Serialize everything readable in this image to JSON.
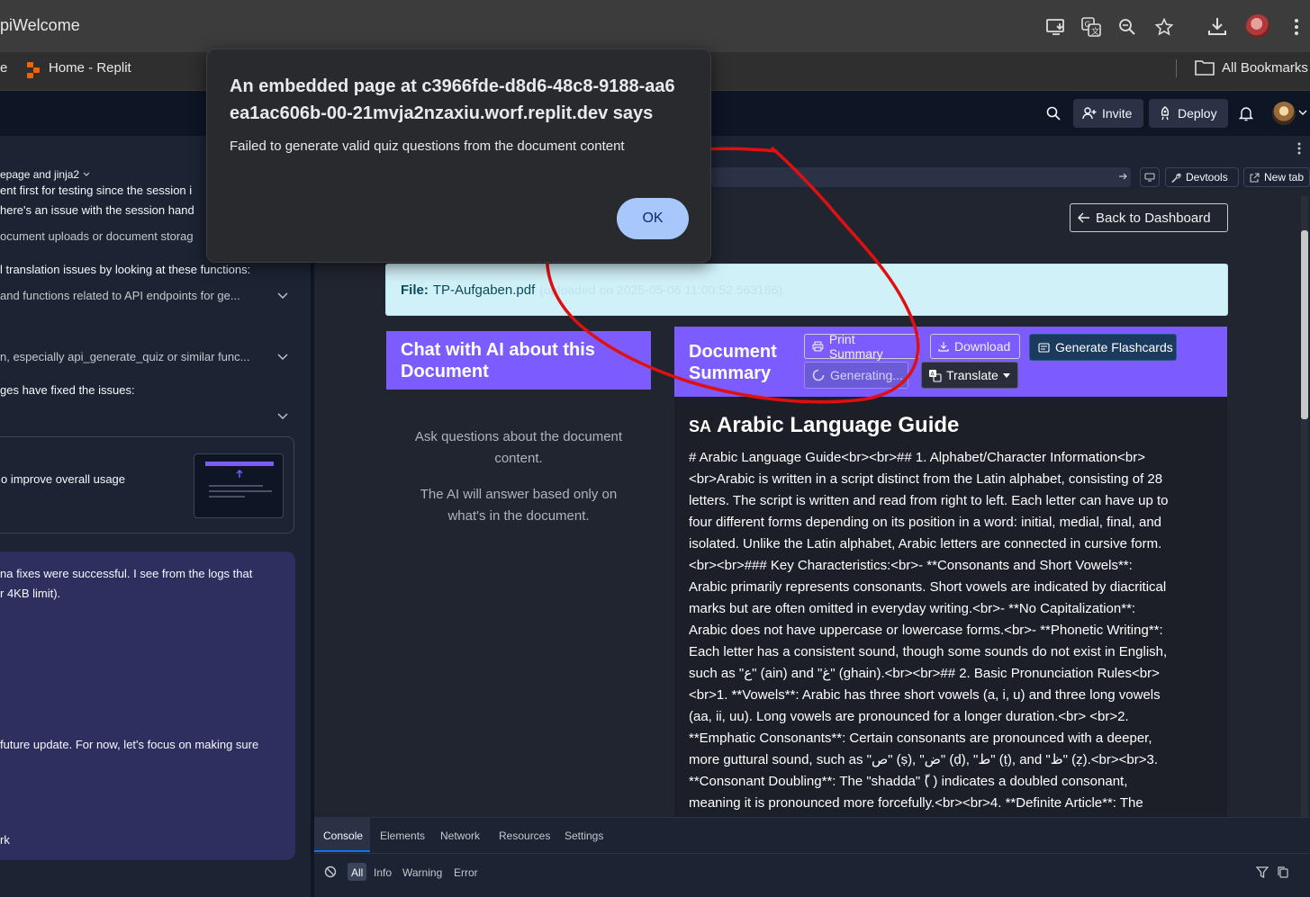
{
  "browser": {
    "tab_title": "piWelcome",
    "bookmarks": [
      {
        "label": "e"
      },
      {
        "label": "Home - Replit"
      }
    ],
    "all_bookmarks": "All Bookmarks"
  },
  "replit_header": {
    "invite": "Invite",
    "deploy": "Deploy"
  },
  "left_panel": {
    "chip": "epage and jinja2",
    "lines": [
      "ent first for testing since the session i",
      "here's an issue with the session hand",
      "ocument uploads or document storag",
      "l translation issues by looking at these functions:",
      "and functions related to API endpoints for ge...",
      "n, especially api_generate_quiz or similar func...",
      "ges have fixed the issues:",
      "o improve overall usage",
      "na fixes were successful. I see from the logs that",
      "r 4KB limit).",
      "future update. For now, let's focus on making sure",
      "rk"
    ]
  },
  "webview_toolbar": {
    "devtools": "Devtools",
    "new_tab": "New tab"
  },
  "app": {
    "back_button": "Back to Dashboard",
    "file_label": "File:",
    "file_name": "TP-Aufgaben.pdf",
    "file_uploaded": "(uploaded on 2025-05-06 11:00:52.563186)",
    "chat_title": "Chat with AI about this Document",
    "chat_hint_1": "Ask questions about the document content.",
    "chat_hint_2": "The AI will answer based only on what's in the document.",
    "summary_title": "Document Summary",
    "btn_print": "Print Summary",
    "btn_download": "Download",
    "btn_flashcards": "Generate Flashcards",
    "btn_generating": "Generating...",
    "btn_translate": "Translate",
    "guide_flag": "SA",
    "guide_title": "Arabic Language Guide",
    "guide_body": [
      "# Arabic Language Guide<br><br>## 1. Alphabet/Character Information<br>",
      "<br>Arabic is written in a script distinct from the Latin alphabet, consisting of 28",
      "letters. The script is written and read from right to left. Each letter can have up to",
      "four different forms depending on its position in a word: initial, medial, final, and",
      "isolated. Unlike the Latin alphabet, Arabic letters are connected in cursive form.",
      "<br><br>### Key Characteristics:<br>- **Consonants and Short Vowels**:",
      "Arabic primarily represents consonants. Short vowels are indicated by diacritical",
      "marks but are often omitted in everyday writing.<br>- **No Capitalization**:",
      "Arabic does not have uppercase or lowercase forms.<br>- **Phonetic Writing**:",
      "Each letter has a consistent sound, though some sounds do not exist in English,",
      "such as \"ع\" (ain) and \"غ\" (ghain).<br><br>## 2. Basic Pronunciation Rules<br>",
      "<br>1. **Vowels**: Arabic has three short vowels (a, i, u) and three long vowels",
      "(aa, ii, uu). Long vowels are pronounced for a longer duration.<br> <br>2.",
      "**Emphatic Consonants**: Certain consonants are pronounced with a deeper,",
      "more guttural sound, such as \"ص\" (ṣ), \"ض\" (ḍ), \"ط\" (ṭ), and \"ظ\" (ẓ).<br><br>3.",
      "**Consonant Doubling**: The \"shadda\" (ّ ) indicates a doubled consonant,",
      "meaning it is pronounced more forcefully.<br><br>4. **Definite Article**: The"
    ]
  },
  "console": {
    "tabs": [
      "Console",
      "Elements",
      "Network",
      "Resources",
      "Settings"
    ],
    "filters": [
      "All",
      "Info",
      "Warning",
      "Error"
    ]
  },
  "dialog": {
    "title": "An embedded page at c3966fde-d8d6-48c8-9188-aa6ea1ac606b-00-21mvja2nzaxiu.worf.replit.dev says",
    "message": "Failed to generate valid quiz questions from the document content",
    "ok": "OK"
  },
  "colors": {
    "accent_purple": "#7c5cff",
    "info_bar": "#d1f1f8",
    "dialog_button": "#a8c7fa",
    "annotation_red": "#e01010"
  }
}
